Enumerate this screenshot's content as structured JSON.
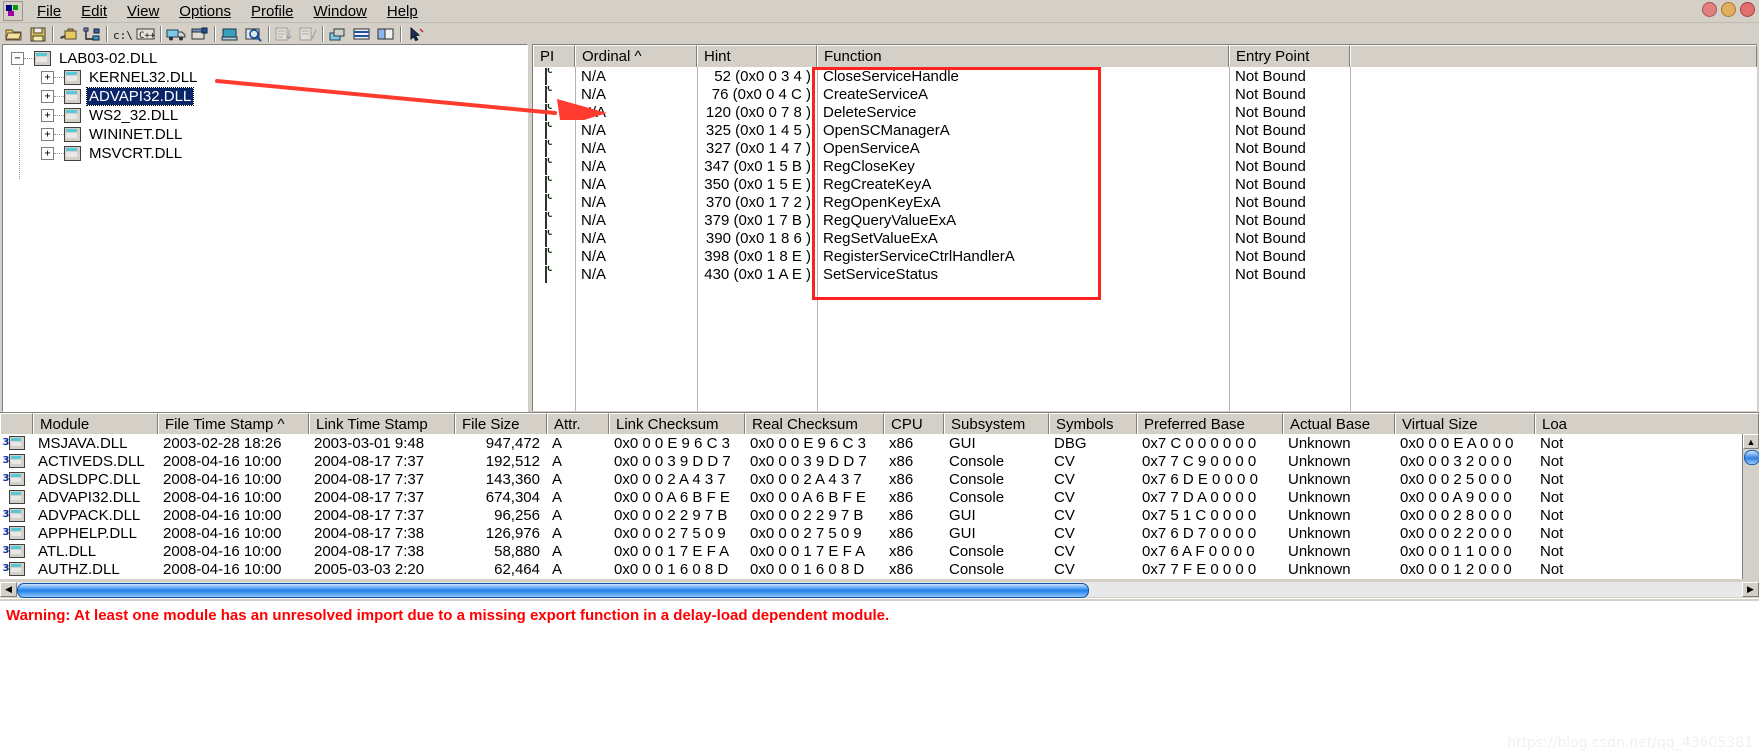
{
  "app": {
    "icon": "dependency-walker-icon",
    "window_buttons": [
      "minimize",
      "maximize",
      "close"
    ]
  },
  "menu": {
    "items": [
      {
        "label": "File",
        "accel": "F"
      },
      {
        "label": "Edit",
        "accel": "E"
      },
      {
        "label": "View",
        "accel": "V"
      },
      {
        "label": "Options",
        "accel": "O"
      },
      {
        "label": "Profile",
        "accel": "P"
      },
      {
        "label": "Window",
        "accel": "W"
      },
      {
        "label": "Help",
        "accel": "H"
      }
    ]
  },
  "toolbar": {
    "buttons": [
      {
        "name": "open-icon",
        "glyph": "folder"
      },
      {
        "name": "save-icon",
        "glyph": "disk"
      },
      {
        "name": "search-path-icon",
        "glyph": "wrench"
      },
      {
        "name": "full-paths-icon",
        "glyph": "path"
      },
      {
        "name": "undecorate-icon",
        "glyph": "c-prompt",
        "label": "c:\\"
      },
      {
        "name": "cplusplus-icon",
        "glyph": "cpp",
        "label": "C++"
      },
      {
        "name": "start-profiling-icon",
        "glyph": "truck"
      },
      {
        "name": "configure-module-icon",
        "glyph": "window-props"
      },
      {
        "name": "system-info-icon",
        "glyph": "computer"
      },
      {
        "name": "view-module-icon",
        "glyph": "magnifier"
      },
      {
        "name": "expand-all-icon",
        "glyph": "expand"
      },
      {
        "name": "collapse-all-icon",
        "glyph": "collapse"
      },
      {
        "name": "auto-expand-icon",
        "glyph": "stack"
      },
      {
        "name": "full-paths-list-icon",
        "glyph": "rows"
      },
      {
        "name": "split-view-icon",
        "glyph": "columns"
      },
      {
        "name": "select-arrow-icon",
        "glyph": "arrow"
      }
    ]
  },
  "tree": {
    "root": {
      "label": "LAB03-02.DLL",
      "expander": "−",
      "selected": false
    },
    "children": [
      {
        "label": "KERNEL32.DLL",
        "expander": "+",
        "selected": false
      },
      {
        "label": "ADVAPI32.DLL",
        "expander": "+",
        "selected": true
      },
      {
        "label": "WS2_32.DLL",
        "expander": "+",
        "selected": false
      },
      {
        "label": "WININET.DLL",
        "expander": "+",
        "selected": false
      },
      {
        "label": "MSVCRT.DLL",
        "expander": "+",
        "selected": false
      }
    ]
  },
  "imports": {
    "columns": [
      "PI",
      "Ordinal ^",
      "Hint",
      "Function",
      "Entry Point",
      ""
    ],
    "rows": [
      {
        "pi": "C",
        "ordinal": "N/A",
        "hint": "52 (0x0 0 3 4 )",
        "function": "CloseServiceHandle",
        "entry_point": "Not Bound"
      },
      {
        "pi": "C",
        "ordinal": "N/A",
        "hint": "76 (0x0 0 4 C )",
        "function": "CreateServiceA",
        "entry_point": "Not Bound"
      },
      {
        "pi": "C",
        "ordinal": "N/A",
        "hint": "120 (0x0 0 7 8 )",
        "function": "DeleteService",
        "entry_point": "Not Bound"
      },
      {
        "pi": "C",
        "ordinal": "N/A",
        "hint": "325 (0x0 1 4 5 )",
        "function": "OpenSCManagerA",
        "entry_point": "Not Bound"
      },
      {
        "pi": "C",
        "ordinal": "N/A",
        "hint": "327 (0x0 1 4 7 )",
        "function": "OpenServiceA",
        "entry_point": "Not Bound"
      },
      {
        "pi": "C",
        "ordinal": "N/A",
        "hint": "347 (0x0 1 5 B )",
        "function": "RegCloseKey",
        "entry_point": "Not Bound"
      },
      {
        "pi": "C",
        "ordinal": "N/A",
        "hint": "350 (0x0 1 5 E )",
        "function": "RegCreateKeyA",
        "entry_point": "Not Bound"
      },
      {
        "pi": "C",
        "ordinal": "N/A",
        "hint": "370 (0x0 1 7 2 )",
        "function": "RegOpenKeyExA",
        "entry_point": "Not Bound"
      },
      {
        "pi": "C",
        "ordinal": "N/A",
        "hint": "379 (0x0 1 7 B )",
        "function": "RegQueryValueExA",
        "entry_point": "Not Bound"
      },
      {
        "pi": "C",
        "ordinal": "N/A",
        "hint": "390 (0x0 1 8 6 )",
        "function": "RegSetValueExA",
        "entry_point": "Not Bound"
      },
      {
        "pi": "C",
        "ordinal": "N/A",
        "hint": "398 (0x0 1 8 E )",
        "function": "RegisterServiceCtrlHandlerA",
        "entry_point": "Not Bound"
      },
      {
        "pi": "C",
        "ordinal": "N/A",
        "hint": "430 (0x0 1 A E )",
        "function": "SetServiceStatus",
        "entry_point": "Not Bound"
      }
    ]
  },
  "modules": {
    "columns": [
      "",
      "Module",
      "File Time Stamp ^",
      "Link Time Stamp",
      "File Size",
      "Attr.",
      "Link Checksum",
      "Real Checksum",
      "CPU",
      "Subsystem",
      "Symbols",
      "Preferred Base",
      "Actual Base",
      "Virtual Size",
      "Loa"
    ],
    "rows": [
      {
        "module": "MSJAVA.DLL",
        "file_time": "2003-02-28 18:26",
        "link_time": "2003-03-01   9:48",
        "file_size": "947,472",
        "attr": "A",
        "link_checksum": "0x0 0 0 E 9 6 C 3",
        "real_checksum": "0x0 0 0 E 9 6 C 3",
        "cpu": "x86",
        "subsystem": "GUI",
        "symbols": "DBG",
        "preferred_base": "0x7 C 0 0 0 0 0 0",
        "actual_base": "Unknown",
        "virtual_size": "0x0 0 0 E A 0 0 0",
        "load": "Not",
        "badge": true
      },
      {
        "module": "ACTIVEDS.DLL",
        "file_time": "2008-04-16 10:00",
        "link_time": "2004-08-17   7:37",
        "file_size": "192,512",
        "attr": "A",
        "link_checksum": "0x0 0 0 3 9 D D 7",
        "real_checksum": "0x0 0 0 3 9 D D 7",
        "cpu": "x86",
        "subsystem": "Console",
        "symbols": "CV",
        "preferred_base": "0x7 7 C 9 0 0 0 0",
        "actual_base": "Unknown",
        "virtual_size": "0x0 0 0 3 2 0 0 0",
        "load": "Not",
        "badge": true
      },
      {
        "module": "ADSLDPC.DLL",
        "file_time": "2008-04-16 10:00",
        "link_time": "2004-08-17   7:37",
        "file_size": "143,360",
        "attr": "A",
        "link_checksum": "0x0 0 0 2 A 4 3 7",
        "real_checksum": "0x0 0 0 2 A 4 3 7",
        "cpu": "x86",
        "subsystem": "Console",
        "symbols": "CV",
        "preferred_base": "0x7 6 D E 0 0 0 0",
        "actual_base": "Unknown",
        "virtual_size": "0x0 0 0 2 5 0 0 0",
        "load": "Not",
        "badge": true
      },
      {
        "module": "ADVAPI32.DLL",
        "file_time": "2008-04-16 10:00",
        "link_time": "2004-08-17   7:37",
        "file_size": "674,304",
        "attr": "A",
        "link_checksum": "0x0 0 0 A 6 B F E",
        "real_checksum": "0x0 0 0 A 6 B F E",
        "cpu": "x86",
        "subsystem": "Console",
        "symbols": "CV",
        "preferred_base": "0x7 7 D A 0 0 0 0",
        "actual_base": "Unknown",
        "virtual_size": "0x0 0 0 A 9 0 0 0",
        "load": "Not",
        "badge": false
      },
      {
        "module": "ADVPACK.DLL",
        "file_time": "2008-04-16 10:00",
        "link_time": "2004-08-17   7:37",
        "file_size": "96,256",
        "attr": "A",
        "link_checksum": "0x0 0 0 2 2 9 7 B",
        "real_checksum": "0x0 0 0 2 2 9 7 B",
        "cpu": "x86",
        "subsystem": "GUI",
        "symbols": "CV",
        "preferred_base": "0x7 5 1 C 0 0 0 0",
        "actual_base": "Unknown",
        "virtual_size": "0x0 0 0 2 8 0 0 0",
        "load": "Not",
        "badge": true
      },
      {
        "module": "APPHELP.DLL",
        "file_time": "2008-04-16 10:00",
        "link_time": "2004-08-17   7:38",
        "file_size": "126,976",
        "attr": "A",
        "link_checksum": "0x0 0 0 2 7 5 0 9",
        "real_checksum": "0x0 0 0 2 7 5 0 9",
        "cpu": "x86",
        "subsystem": "GUI",
        "symbols": "CV",
        "preferred_base": "0x7 6 D 7 0 0 0 0",
        "actual_base": "Unknown",
        "virtual_size": "0x0 0 0 2 2 0 0 0",
        "load": "Not",
        "badge": true
      },
      {
        "module": "ATL.DLL",
        "file_time": "2008-04-16 10:00",
        "link_time": "2004-08-17   7:38",
        "file_size": "58,880",
        "attr": "A",
        "link_checksum": "0x0 0 0 1 7 E F A",
        "real_checksum": "0x0 0 0 1 7 E F A",
        "cpu": "x86",
        "subsystem": "Console",
        "symbols": "CV",
        "preferred_base": "0x7 6 A F 0 0 0 0",
        "actual_base": "Unknown",
        "virtual_size": "0x0 0 0 1 1 0 0 0",
        "load": "Not",
        "badge": true
      },
      {
        "module": "AUTHZ.DLL",
        "file_time": "2008-04-16 10:00",
        "link_time": "2005-03-03   2:20",
        "file_size": "62,464",
        "attr": "A",
        "link_checksum": "0x0 0 0 1 6 0 8 D",
        "real_checksum": "0x0 0 0 1 6 0 8 D",
        "cpu": "x86",
        "subsystem": "Console",
        "symbols": "CV",
        "preferred_base": "0x7 7 F E 0 0 0 0",
        "actual_base": "Unknown",
        "virtual_size": "0x0 0 0 1 2 0 0 0",
        "load": "Not",
        "badge": true
      }
    ]
  },
  "log": {
    "warning": "Warning: At least one module has an unresolved import due to a missing export function in a delay-load dependent module."
  },
  "watermark": "https://blog.csdn.net/qq_43605381",
  "colors": {
    "selection": "#0a246a",
    "warning": "#ff0000",
    "highlight_box": "#ff2020",
    "arrow": "#ff3b30",
    "chrome": "#d4d0c8"
  }
}
